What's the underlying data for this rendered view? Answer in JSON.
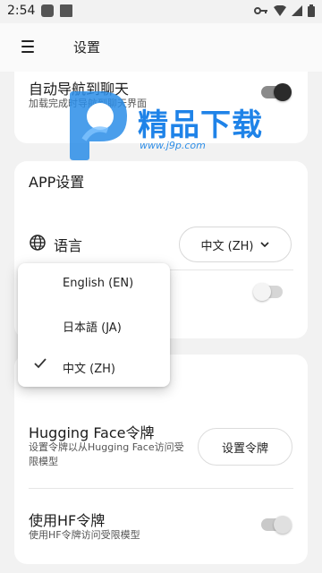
{
  "status_bar": {
    "time": "2:54"
  },
  "app_bar": {
    "title": "设置"
  },
  "auto_nav": {
    "title": "自动导航到聊天",
    "subtitle": "加载完成时导航到聊天界面",
    "enabled": true
  },
  "app_settings": {
    "section_title": "APP设置",
    "language_label": "语言",
    "language_value": "中文 (ZH)",
    "second_toggle_enabled": false
  },
  "language_menu": {
    "options": [
      {
        "label": "English (EN)",
        "selected": false
      },
      {
        "label": "日本語 (JA)",
        "selected": false
      },
      {
        "label": "中文 (ZH)",
        "selected": true
      }
    ]
  },
  "hf": {
    "token_title": "Hugging Face令牌",
    "token_subtitle": "设置令牌以从Hugging Face访问受限模型",
    "token_button": "设置令牌",
    "use_title": "使用HF令牌",
    "use_subtitle": "使用HF令牌访问受限模型",
    "use_enabled": true
  },
  "watermark": {
    "text": "精品下载",
    "url": "www.j9p.com"
  },
  "colors": {
    "accent_dark": "#2b2b2b",
    "watermark_blue": "#1f83e8"
  }
}
